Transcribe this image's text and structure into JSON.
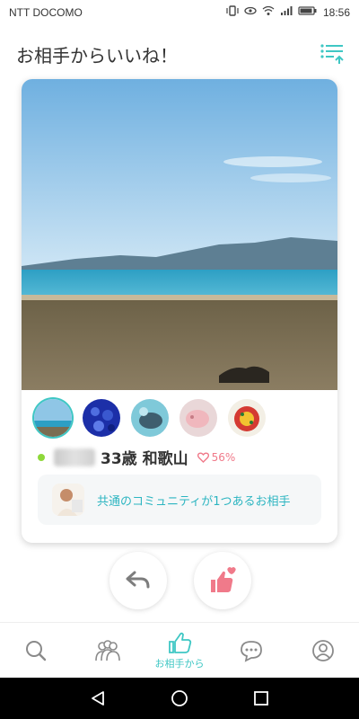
{
  "status_bar": {
    "carrier": "NTT DOCOMO",
    "time": "18:56"
  },
  "header": {
    "title": "お相手からいいね！",
    "filter_icon": "list-sort-icon"
  },
  "card": {
    "photo_description_icon": "profile-photo",
    "thumbnails": [
      "photo-1",
      "photo-2",
      "photo-3",
      "photo-4",
      "photo-5"
    ],
    "age_location": "33歳 和歌山",
    "match_percent": "56%",
    "community_text": "共通のコミュニティが1つあるお相手"
  },
  "actions": {
    "back_icon": "undo-arrow-icon",
    "like_icon": "thumbs-up-heart-icon"
  },
  "bottom_nav": {
    "items": [
      {
        "name": "search",
        "icon": "search-icon",
        "label": ""
      },
      {
        "name": "people",
        "icon": "people-icon",
        "label": ""
      },
      {
        "name": "likes",
        "icon": "thumbs-up-icon",
        "label": "お相手から"
      },
      {
        "name": "messages",
        "icon": "chat-icon",
        "label": ""
      },
      {
        "name": "profile",
        "icon": "user-icon",
        "label": ""
      }
    ]
  },
  "colors": {
    "accent": "#3fc7c4",
    "like": "#f07a8a",
    "online": "#8ed83a"
  }
}
